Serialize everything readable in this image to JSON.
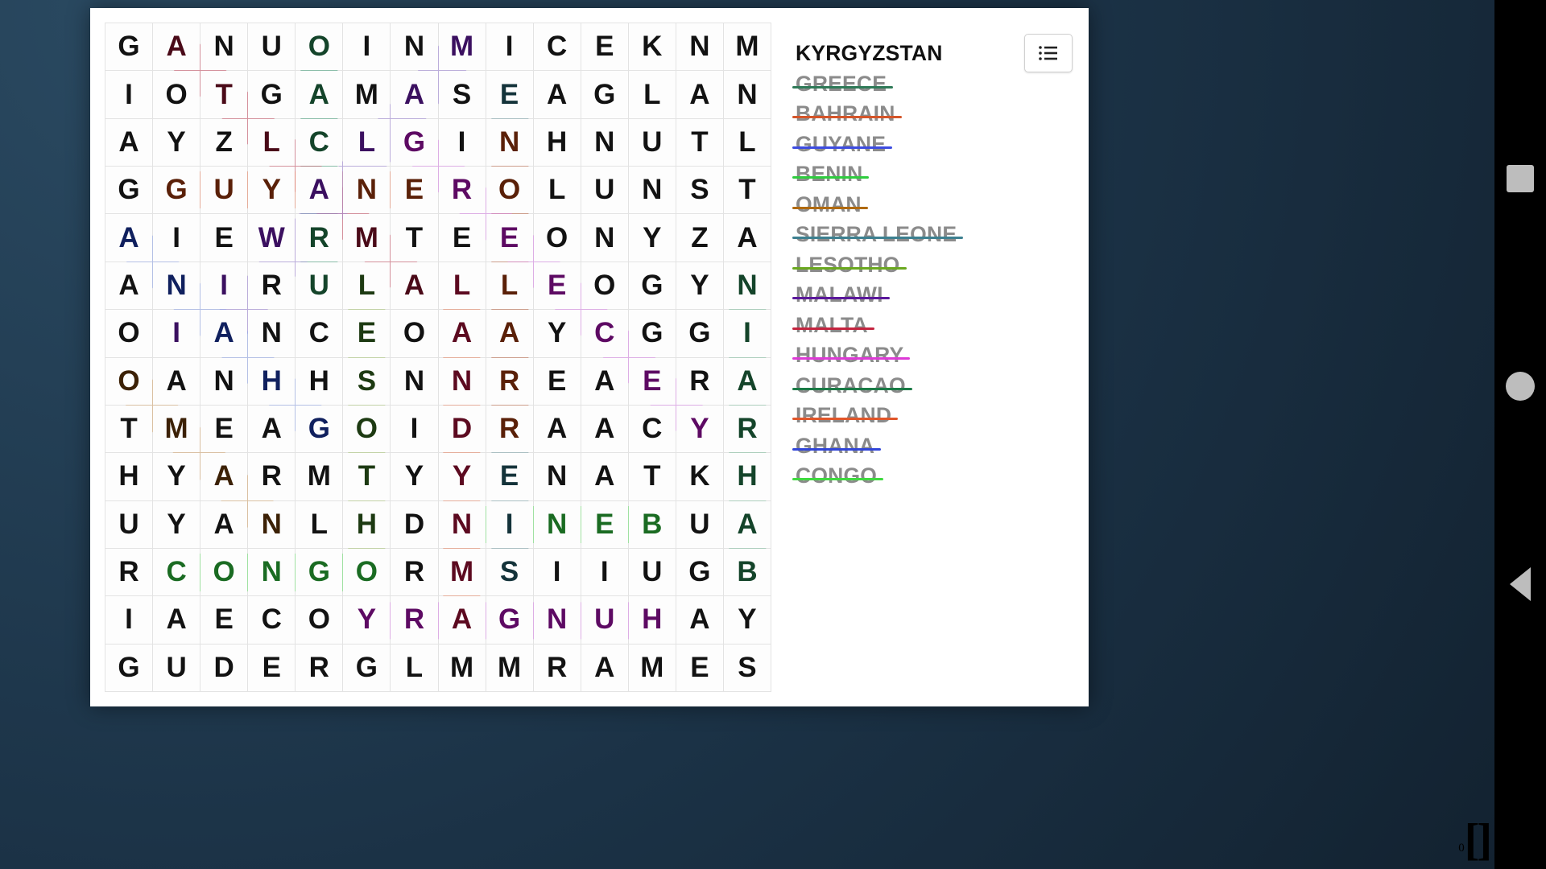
{
  "window": {
    "title": "Word Search"
  },
  "grid": {
    "rows": 14,
    "cols": 14,
    "letters": [
      [
        "G",
        "A",
        "N",
        "U",
        "O",
        "I",
        "N",
        "M",
        "I",
        "C",
        "E",
        "K",
        "N",
        "M"
      ],
      [
        "I",
        "O",
        "T",
        "G",
        "A",
        "M",
        "A",
        "S",
        "E",
        "A",
        "G",
        "L",
        "A",
        "N"
      ],
      [
        "A",
        "Y",
        "Z",
        "L",
        "C",
        "L",
        "G",
        "I",
        "N",
        "H",
        "N",
        "U",
        "T",
        "L"
      ],
      [
        "G",
        "G",
        "U",
        "Y",
        "A",
        "N",
        "E",
        "R",
        "O",
        "L",
        "U",
        "N",
        "S",
        "T"
      ],
      [
        "A",
        "I",
        "E",
        "W",
        "R",
        "M",
        "T",
        "E",
        "E",
        "O",
        "N",
        "Y",
        "Z",
        "A"
      ],
      [
        "A",
        "N",
        "I",
        "R",
        "U",
        "L",
        "A",
        "L",
        "L",
        "E",
        "O",
        "G",
        "Y",
        "N"
      ],
      [
        "O",
        "I",
        "A",
        "N",
        "C",
        "E",
        "O",
        "A",
        "A",
        "Y",
        "C",
        "G",
        "G",
        "I"
      ],
      [
        "O",
        "A",
        "N",
        "H",
        "H",
        "S",
        "N",
        "N",
        "R",
        "E",
        "A",
        "E",
        "R",
        "A"
      ],
      [
        "T",
        "M",
        "E",
        "A",
        "G",
        "O",
        "I",
        "D",
        "R",
        "A",
        "A",
        "C",
        "Y",
        "R"
      ],
      [
        "H",
        "Y",
        "A",
        "R",
        "M",
        "T",
        "Y",
        "Y",
        "E",
        "N",
        "A",
        "T",
        "K",
        "H"
      ],
      [
        "U",
        "Y",
        "A",
        "N",
        "L",
        "H",
        "D",
        "N",
        "I",
        "N",
        "E",
        "B",
        "U",
        "A"
      ],
      [
        "R",
        "C",
        "O",
        "N",
        "G",
        "O",
        "R",
        "M",
        "S",
        "I",
        "I",
        "U",
        "G",
        "B"
      ],
      [
        "I",
        "A",
        "E",
        "C",
        "O",
        "Y",
        "R",
        "A",
        "G",
        "N",
        "U",
        "H",
        "A",
        "Y"
      ],
      [
        "G",
        "U",
        "D",
        "E",
        "R",
        "G",
        "L",
        "M",
        "M",
        "R",
        "A",
        "M",
        "E",
        "S"
      ]
    ]
  },
  "wordlist": {
    "items": [
      {
        "label": "KYRGYZSTAN",
        "found": false,
        "color": "#111111"
      },
      {
        "label": "GREECE",
        "found": true,
        "color": "#2f7a58"
      },
      {
        "label": "BAHRAIN",
        "found": true,
        "color": "#d4552a"
      },
      {
        "label": "GUYANE",
        "found": true,
        "color": "#3d4ce0"
      },
      {
        "label": "BENIN",
        "found": true,
        "color": "#2fcc3f"
      },
      {
        "label": "OMAN",
        "found": true,
        "color": "#b06a10"
      },
      {
        "label": "SIERRA LEONE",
        "found": true,
        "color": "#3d8090"
      },
      {
        "label": "LESOTHO",
        "found": true,
        "color": "#6aa81f"
      },
      {
        "label": "MALAWI",
        "found": true,
        "color": "#5a189a"
      },
      {
        "label": "MALTA",
        "found": true,
        "color": "#c4243f"
      },
      {
        "label": "HUNGARY",
        "found": true,
        "color": "#dd3ad6"
      },
      {
        "label": "CURACAO",
        "found": true,
        "color": "#1b7a46"
      },
      {
        "label": "IRELAND",
        "found": true,
        "color": "#e0562a"
      },
      {
        "label": "GHANA",
        "found": true,
        "color": "#3246d8"
      },
      {
        "label": "CONGO",
        "found": true,
        "color": "#3fd93f"
      }
    ]
  },
  "toolbar": {
    "menu_icon": "list-icon"
  },
  "navbar": {
    "recent_label": "recent-apps",
    "home_label": "home",
    "back_label": "back"
  },
  "counter": {
    "superscript": "0",
    "value": "[]"
  },
  "highlights": [
    {
      "name": "greece",
      "r1": 0,
      "c1": 4,
      "r2": 5,
      "c2": 4,
      "color": "#3f9e79"
    },
    {
      "name": "bahrain",
      "r1": 0,
      "c1": 1,
      "r2": 5,
      "c2": 6,
      "color": "#c94f63"
    },
    {
      "name": "guyane",
      "r1": 3,
      "c1": 1,
      "r2": 3,
      "c2": 6,
      "color": "#e8825f"
    },
    {
      "name": "benin",
      "r1": 10,
      "c1": 7,
      "r2": 10,
      "c2": 11,
      "color": "#69e06e"
    },
    {
      "name": "oman",
      "r1": 7,
      "c1": 0,
      "r2": 10,
      "c2": 3,
      "color": "#d3a46d"
    },
    {
      "name": "sierra-leone",
      "r1": 1,
      "c1": 8,
      "r2": 11,
      "c2": 8,
      "color": "#7ba2a8"
    },
    {
      "name": "lesotho",
      "r1": 5,
      "c1": 5,
      "r2": 11,
      "c2": 5,
      "color": "#a8c474"
    },
    {
      "name": "malawi",
      "r1": 0,
      "c1": 7,
      "r2": 6,
      "c2": 2,
      "color": "#9b82d4"
    },
    {
      "name": "malta",
      "r1": 2,
      "c1": 8,
      "r2": 8,
      "c2": 8,
      "color": "#e8825f"
    },
    {
      "name": "hungary",
      "r1": 12,
      "c1": 11,
      "r2": 12,
      "c2": 5,
      "color": "#d884e8"
    },
    {
      "name": "curacao",
      "r1": 2,
      "c1": 6,
      "r2": 8,
      "c2": 12,
      "color": "#d884e8"
    },
    {
      "name": "ireland",
      "r1": 5,
      "c1": 7,
      "r2": 12,
      "c2": 7,
      "color": "#e8825f"
    },
    {
      "name": "ghana",
      "r1": 4,
      "c1": 0,
      "r2": 8,
      "c2": 4,
      "color": "#8ea4e8"
    },
    {
      "name": "congo",
      "r1": 11,
      "c1": 1,
      "r2": 11,
      "c2": 5,
      "color": "#69e06e"
    },
    {
      "name": "nigeria",
      "r1": 5,
      "c1": 13,
      "r2": 11,
      "c2": 13,
      "color": "#7fbd9d"
    }
  ]
}
